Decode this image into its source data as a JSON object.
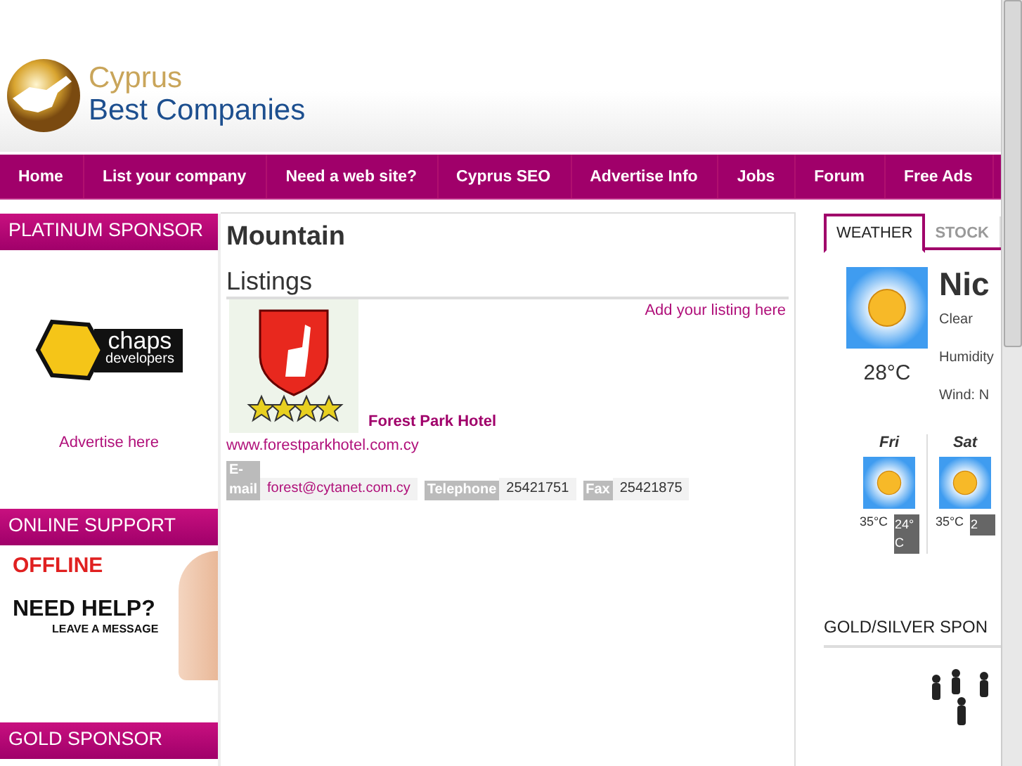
{
  "header": {
    "logo_top": "Cyprus",
    "logo_bottom": "Best Companies"
  },
  "nav": [
    {
      "label": "Home"
    },
    {
      "label": "List your company"
    },
    {
      "label": "Need a web site?"
    },
    {
      "label": "Cyprus SEO"
    },
    {
      "label": "Advertise Info"
    },
    {
      "label": "Jobs"
    },
    {
      "label": "Forum"
    },
    {
      "label": "Free Ads"
    }
  ],
  "left": {
    "platinum_title": "PLATINUM SPONSOR",
    "sponsor_logo_name": "chaps",
    "sponsor_logo_sub": "developers",
    "advertise": "Advertise here",
    "support_title": "ONLINE SUPPORT",
    "support_status": "OFFLINE",
    "support_headline": "NEED HELP?",
    "support_sub": "LEAVE A MESSAGE",
    "gold_title": "GOLD SPONSOR"
  },
  "main": {
    "title": "Mountain",
    "listings_heading": "Listings",
    "add_listing": "Add your listing here",
    "listing": {
      "name": "Forest Park Hotel",
      "website": "www.forestparkhotel.com.cy",
      "fields": [
        {
          "label": "E-mail",
          "value": "forest@cytanet.com.cy",
          "kind": "link"
        },
        {
          "label": "Telephone",
          "value": "25421751",
          "kind": "text"
        },
        {
          "label": "Fax",
          "value": "25421875",
          "kind": "text"
        }
      ]
    }
  },
  "right": {
    "tabs": [
      {
        "label": "WEATHER",
        "selected": true
      },
      {
        "label": "STOCK",
        "selected": false
      }
    ],
    "weather": {
      "city": "Nic",
      "temp": "28°C",
      "condition": "Clear",
      "humidity": "Humidity",
      "wind": "Wind: N",
      "forecast": [
        {
          "day": "Fri",
          "high": "35°C",
          "low": "24°C"
        },
        {
          "day": "Sat",
          "high": "35°C",
          "low": "2"
        }
      ]
    },
    "sponsors_title": "GOLD/SILVER SPON"
  }
}
